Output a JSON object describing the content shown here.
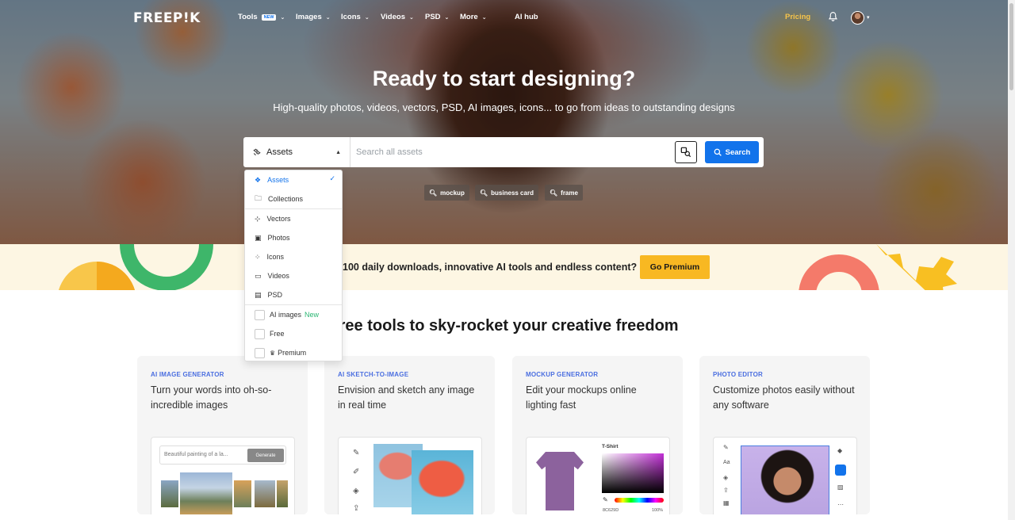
{
  "nav": {
    "logo": "FREEP!K",
    "items": [
      {
        "label": "Tools",
        "badge": "NEW"
      },
      {
        "label": "Images"
      },
      {
        "label": "Icons"
      },
      {
        "label": "Videos"
      },
      {
        "label": "PSD"
      },
      {
        "label": "More"
      }
    ],
    "ai_hub": "AI hub",
    "pricing": "Pricing"
  },
  "hero": {
    "title": "Ready to start designing?",
    "subtitle": "High-quality photos, videos, vectors, PSD, AI images, icons... to go from ideas to outstanding designs"
  },
  "search": {
    "selected_type": "Assets",
    "placeholder": "Search all assets",
    "button_label": "Search"
  },
  "dropdown": {
    "group1": [
      {
        "label": "Assets",
        "selected": true
      },
      {
        "label": "Collections"
      }
    ],
    "group2": [
      {
        "label": "Vectors"
      },
      {
        "label": "Photos"
      },
      {
        "label": "Icons"
      },
      {
        "label": "Videos"
      },
      {
        "label": "PSD"
      }
    ],
    "filters": [
      {
        "label": "AI images",
        "badge": "New"
      },
      {
        "label": "Free"
      },
      {
        "label": "Premium"
      }
    ]
  },
  "tags": [
    "mockup",
    "business card",
    "frame"
  ],
  "promo": {
    "text": "100 daily downloads, innovative AI tools and endless content?",
    "button": "Go Premium"
  },
  "section_title": "Free tools to sky-rocket your creative freedom",
  "cards": [
    {
      "kicker": "AI IMAGE GENERATOR",
      "desc": "Turn your words into oh-so-incredible images",
      "prompt_placeholder": "Beautiful painting of a la...",
      "generate": "Generate"
    },
    {
      "kicker": "AI SKETCH-TO-IMAGE",
      "desc": "Envision and sketch any image in real time"
    },
    {
      "kicker": "MOCKUP GENERATOR",
      "desc": "Edit your mockups online lighting fast",
      "panel_title": "T-Shirt",
      "hex": "8C629D",
      "percent": "100%"
    },
    {
      "kicker": "PHOTO EDITOR",
      "desc": "Customize photos easily without any software"
    }
  ],
  "colors": {
    "primary": "#1273eb",
    "premium": "#f8b822",
    "pricing": "#f7c44b",
    "kicker": "#4a6ee0",
    "new_green": "#2bb673"
  }
}
